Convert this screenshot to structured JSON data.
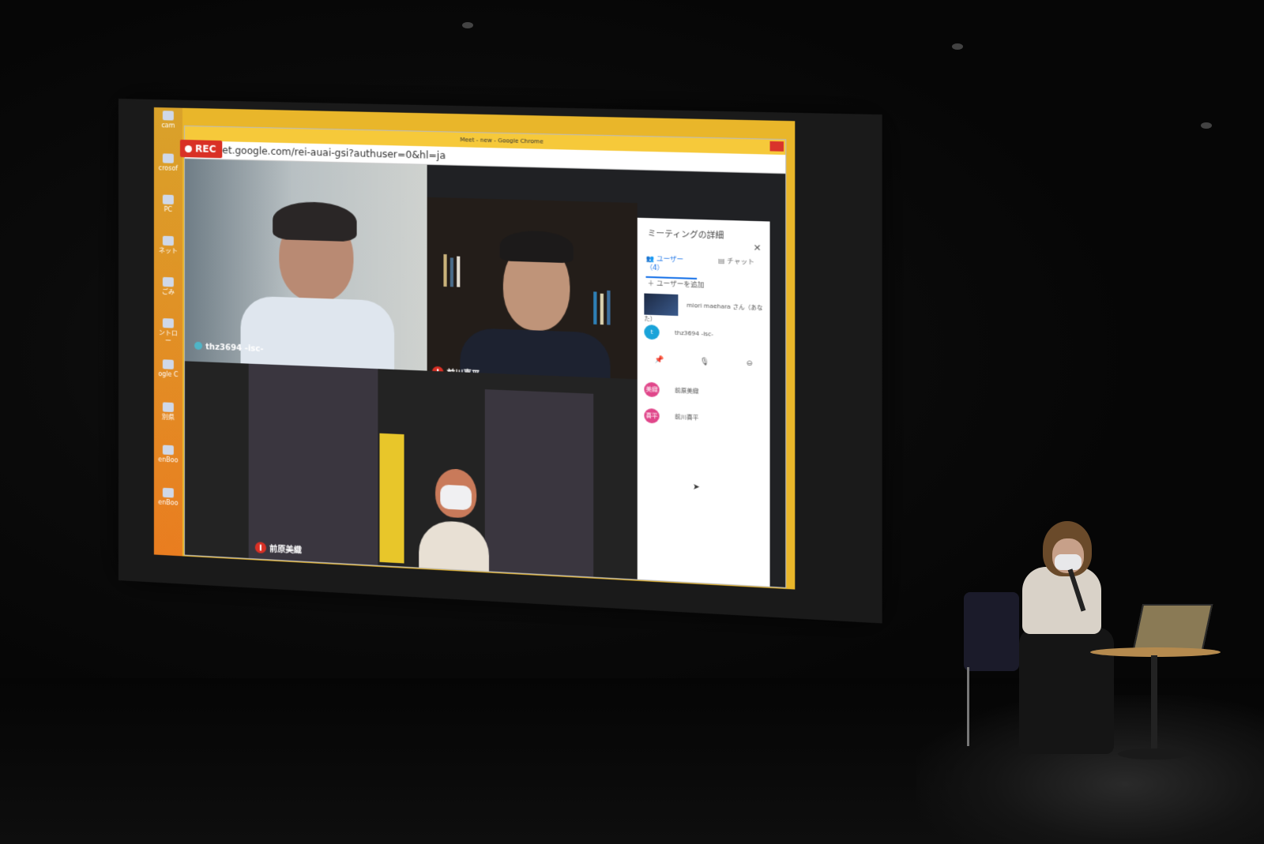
{
  "desktop": {
    "icons": [
      "cam",
      "crosof",
      "PC",
      "ネット",
      "ごみ",
      "ントロー",
      "ogle C",
      "別県",
      "enBoo",
      "enBoo"
    ]
  },
  "browser": {
    "window_title": "Meet - new - Google Chrome",
    "url": "meet.google.com/rei-auai-gsi?authuser=0&hl=ja"
  },
  "meet": {
    "rec_label": "REC",
    "tiles": [
      {
        "label": "thz3694 -isc-",
        "muted": false
      },
      {
        "label": "前川喜平",
        "muted": true
      },
      {
        "label": "前原美織",
        "muted": true
      }
    ]
  },
  "panel": {
    "title": "ミーティングの詳細",
    "tab_users": "ユーザー（4）",
    "tab_chat": "チャット",
    "add_user": "ユーザーを追加",
    "participants": [
      {
        "name": "miori maehara さん（あなた）",
        "avatar": ""
      },
      {
        "name": "thz3694 -isc-",
        "avatar": "t",
        "color": "#1aa3d9"
      },
      {
        "name": "前原美織",
        "avatar": "美織",
        "color": "#e0468a"
      },
      {
        "name": "前川喜平",
        "avatar": "喜平",
        "color": "#e0468a"
      }
    ]
  },
  "colors": {
    "desktop_yellow": "#e9b62a",
    "rec_red": "#d93025",
    "accent_blue": "#1a73e8"
  }
}
